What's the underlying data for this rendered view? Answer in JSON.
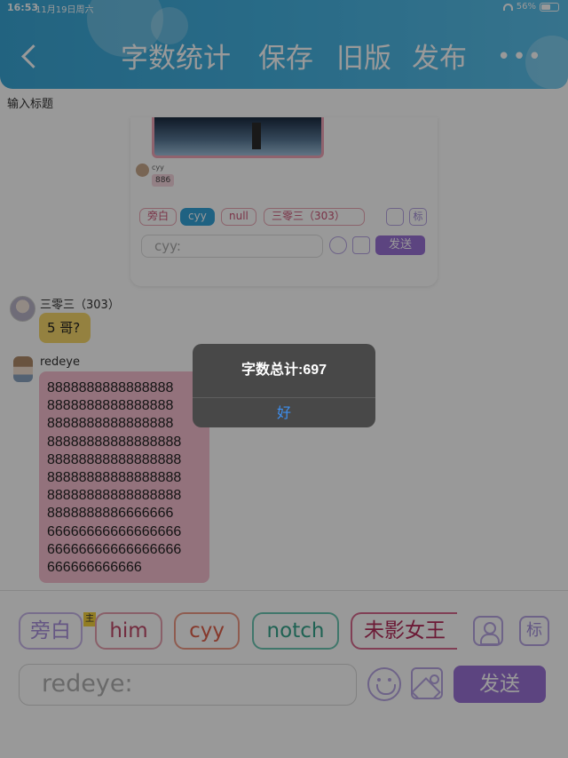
{
  "status_bar": {
    "time": "16:53",
    "date": "11月19日周六",
    "battery": "56%"
  },
  "header": {
    "word_count_btn": "字数统计",
    "save_btn": "保存",
    "old_version_btn": "旧版",
    "publish_btn": "发布",
    "more_btn": "•••"
  },
  "title_input": {
    "placeholder": "输入标题"
  },
  "preview": {
    "sender": "cyy",
    "message": "886",
    "chips": [
      "旁白",
      "cyy",
      "null",
      "三零三（303）"
    ],
    "tag_icon_label": "标",
    "input_placeholder": "cyy:",
    "send_label": "发送"
  },
  "messages": [
    {
      "name": "三零三（303）",
      "text": "5 哥?"
    },
    {
      "name": "redeye",
      "lines": [
        "8888888888888888",
        "8888888888888888",
        "8888888888888888",
        "88888888888888888",
        "88888888888888888",
        "88888888888888888",
        "88888888888888888",
        "8888888886666666",
        "66666666666666666",
        "66666666666666666",
        "666666666666"
      ]
    }
  ],
  "panel": {
    "chips": [
      "旁白",
      "him",
      "cyy",
      "notch",
      "未影女王"
    ],
    "host_badge": "主",
    "tag_icon_label": "标",
    "input_placeholder": "redeye:",
    "send_label": "发送"
  },
  "alert": {
    "title": "字数总计:697",
    "ok_label": "好"
  }
}
